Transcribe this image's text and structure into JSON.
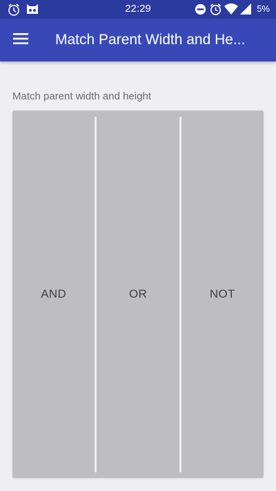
{
  "status_bar": {
    "time": "22:29",
    "battery": "5%",
    "icons": [
      "alarm-clock-icon",
      "cat-face-icon",
      "do-not-disturb-icon",
      "alarm-icon",
      "wifi-icon",
      "signal-icon"
    ]
  },
  "app_bar": {
    "title": "Match Parent Width and He...",
    "menu_icon": "hamburger-menu-icon",
    "color": "#3849b7"
  },
  "content": {
    "section_label": "Match parent width and height",
    "buttons": [
      {
        "label": "AND"
      },
      {
        "label": "OR"
      },
      {
        "label": "NOT"
      }
    ]
  },
  "colors": {
    "status_bar": "#2b3a9e",
    "app_bar": "#3849b7",
    "background": "#efeef2",
    "button_group": "#bebdc1"
  }
}
